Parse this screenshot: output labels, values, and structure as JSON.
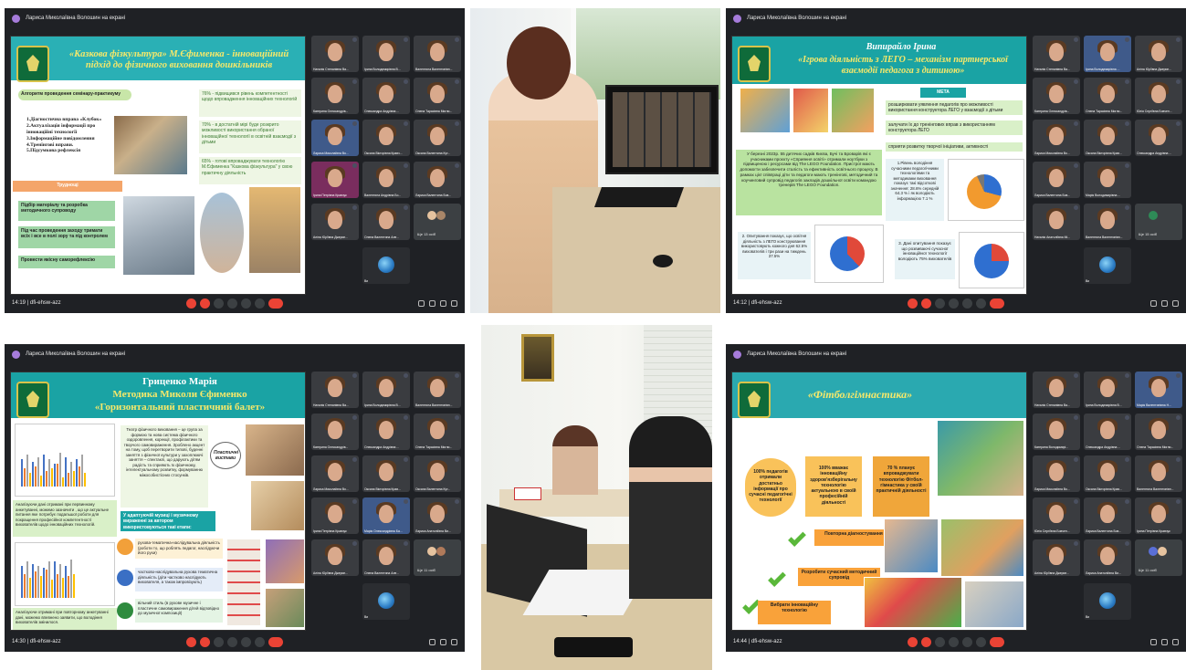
{
  "panels": {
    "p1": {
      "owner": "Лариса Миколаївна Волошин на екрані",
      "slide_title": "«Казкова фізкультура» М.Єфименка - інноваційний підхід до фізичного виховання дошкільників",
      "heading": "Алгоритм проведення семінару-практикуму",
      "steps": "1.Діагностична вправа «Клубок» 2.Актуалізація інформації про інноваційні технології 3.Інформаційне повідомлення 4.Тренінгові вправи. 5.Підсумкова рефлексія",
      "stat1": "76% - підвищився рівень компетентності щодо впровадження інноваційних технологій",
      "stat2": "70% - в достатній мірі буде розкрито можливості використання обраної інноваційної технології в освітній взаємодії з дітьми",
      "stat3": "65% - готові впроваджувати технологію М.Єфименка \"Казкова фізкультура\" у свою практичну діяльність",
      "difficulties": "Труднощі",
      "d1": "Підбір матеріалу та розробка методичного супроводу",
      "d2": "Під час проведення заходу тримати всіх і все в полі зору та під контролем",
      "d3": "Провести якісну саморефлексію",
      "time": "14:19",
      "code": "dfi-ehsw-azz"
    },
    "p3": {
      "owner": "Лариса Миколаївна Волошин на екрані",
      "speaker": "Випирайло Ірина",
      "slide_title": "«Ігрова діяльність з ЛЕГО – механізм партнерської взаємодії педагога з дитиною»",
      "meta_label": "МЕТА",
      "goal1": "розширювати уявлення педагогів про можливості використання конструктора ЛЕГО у взаємодії з дітьми",
      "goal2": "залучати їх до тренінгових вправ з використанням конструктора ЛЕГО",
      "goal3": "сприяти розвитку творчої ініціативи, активності",
      "body": "У березні 2023р. 55 дитячих садків Києва, Бучі та Броварів які є учасниками проєкту «Сприяння освіті» отримали ноутбуки з підвищеною і ресурсами від The LEGO Foundation. Пристрої мають допомогти забезпечити сталість та ефективність освітнього процесу. В рамках цієї співпраці діти та педагоги мають тренінгові, методичний та коучинговий супровід педагогів закладів дошкільної освіти командою тренерів The LEGO Foundation.",
      "card1": "1.Рівень володіння сучасними педагогічними технологіями та методиками виховання показує такі відсоткові значення: 28.6% середній 64.3 % і як володіють інформацією 7.1 %",
      "card2": "2. Опитування показує, що освітня діяльність з ЛЕГО конструювання використовують кожного дня 62.5% вихователів і три рази на тиждень 37.5%",
      "card3": "3. Дані опитування показує що розвиваючі сучасної інноваційної технології володіють 75% вихователів",
      "time": "14:12",
      "code": "dfi-ehsw-azz"
    },
    "p4": {
      "owner": "Лариса Миколаївна Волошин на екрані",
      "speaker": "Гриценко Марія",
      "line2": "Методика Миколи Єфименко",
      "line3": "«Горизонтальний пластичний балет»",
      "para1": "Театр фізичного виховання – це група за формою та нова система фізичного оздоровлення, корекції, профілактики та творчого самовираження. Зроблено акцент на тому, щоб перетворити типові, буденні заняття з фізичної культури у захоплюючі заняття – спектаклі, що дарують дітям радість та сприяють їх фізичному, інтелектуальному розвитку, формуванню міжособистісних стосунків.",
      "callout": "Пластичні вистави",
      "part_head": "У адаптуючій музиці і музичному вираженні за автором використовуються такі етапи:",
      "e1": "рухова-тематична-наслідувальна діяльність (роботи то, що роблять педагог, наслідуючи його рухи)",
      "e2": "частково-наслідувальна рухова тематична діяльність (діти частково наслідують вихователя, а також імпровізують)",
      "e3": "вільний стиль (в рухове музичне і пластичне самовираження дітей відповідно до музичної композиції)",
      "analysis1": "Аналізуючи дані отримані при первинному анкетуванні, можемо зазначити , що це актуальне питання яке потребує подальшої роботи для покращення професійної компетентності вихователів щодо інноваційних технологій.",
      "analysis2": "Аналізуючи отримані при повторному анкетуванні дані, можемо впевнено заявити, що володіння вихователів змінилося.",
      "time": "14:30",
      "code": "dfi-ehsw-azz"
    },
    "p6": {
      "owner": "Лариса Миколаївна Волошин на екрані",
      "slide_title": "«Фітболгімнастика»",
      "stat1": "100% педагогів отримали достатньо інформації про сучасні педагогічні технології",
      "stat2": "100% вважає інноваційну здоров'язберігальну технологію актуальною в своїй професійній діяльності",
      "stat3": "70 % планує впроваджувати технологію Фітбол-гімнастика у своїй практичній діяльності",
      "item1": "Повторна діагностування",
      "item2": "Розробити сучасний методичний супровід",
      "item3": "Вибрати інноваційну технологію",
      "time": "14:44",
      "code": "dfi-ehsw-azz"
    }
  },
  "participants": {
    "a1": "Наталія Степанівна Ва...",
    "a2": "Ірина Володимирівна В...",
    "a3": "Валентина Валентинівн...",
    "a4": "Катерина Олександрів...",
    "a5": "Олександра Андрівна ...",
    "a6": "Олена Тарасівна Мигли...",
    "a7": "Лариса Миколаївна Во...",
    "a8": "Оксана Вікторівна Кравч...",
    "a9": "Оксана Валентина Кут...",
    "a10": "Ірина Петрівна Кравчук",
    "a11": "Валентина Андрівна Бо...",
    "a12": "Лариса Валентина Бов...",
    "a13": "Аліна Юріївна Джерин...",
    "a14": "Олена Валентина Але...",
    "b1": "Наталія Степанівна Ва...",
    "b2": "Ірина Володимирівна ...",
    "b3": "Аліна Юріївна Джерин...",
    "b4": "Катерина Олександрів...",
    "b5": "Олена Тарасівна Мигли...",
    "b6": "Юлія Сергіївна Бовчен...",
    "b7": "Лариса Миколаївна Во...",
    "b8": "Оксана Вікторівна Крав...",
    "b9": "Олександра Андрівна ...",
    "b10": "Лариса Валентина Бов...",
    "b11": "Марія Володимирівна ...",
    "b12": "Наталія Анатоліївна Мі...",
    "b13": "Валентина Валентинівн...",
    "c1": "Наталія Степанівна Ва...",
    "c2": "Ірина Володимирівна В...",
    "c3": "Валентина Валентинівн...",
    "c4": "Катерина Олександрів...",
    "c5": "Олександра Андрівна ...",
    "c6": "Олена Тарасівна Мигли...",
    "c7": "Лариса Миколаївна Во...",
    "c8": "Оксана Вікторівна Крав...",
    "c9": "Оксана Валентина Кут...",
    "c10": "Ірина Петрівна Кравчук",
    "c11": "Марія Олександрівна Ба...",
    "c12": "Лариса Анатоліївна Ви...",
    "c13": "Аліна Юріївна Джерин...",
    "c14": "Олена Валентина Але...",
    "d1": "Наталія Степанівна Ва...",
    "d2": "Ірина Володимирівна В...",
    "d3": "Марія Валентинівна Н...",
    "d4": "Катерина Володимирі...",
    "d5": "Олександра Андрівна ...",
    "d6": "Олена Тарасівна Мигли...",
    "d7": "Лариса Миколаївна Во...",
    "d8": "Оксана Вікторівна Крав...",
    "d9": "Валентина Валентинівн...",
    "d10": "Юлія Сергіївна Бовчен...",
    "d11": "Лариса Валентина Бов...",
    "d12": "Ірина Петрівна Кравчук",
    "d13": "Аліна Юріївна Джерин...",
    "d14": "Лариса Анатоліївна Ви...",
    "others_a": "Ще 13 осіб",
    "others_b": "Ще 15 осіб",
    "others_c": "Ще 11 осіб",
    "others_d": "Ще 11 осіб",
    "you": "Ви"
  },
  "colors": {
    "meet_bg": "#1f2125",
    "end_call": "#ea4335",
    "slide_teal": "#1a9aa0",
    "slide_green": "#0f6b3a"
  }
}
